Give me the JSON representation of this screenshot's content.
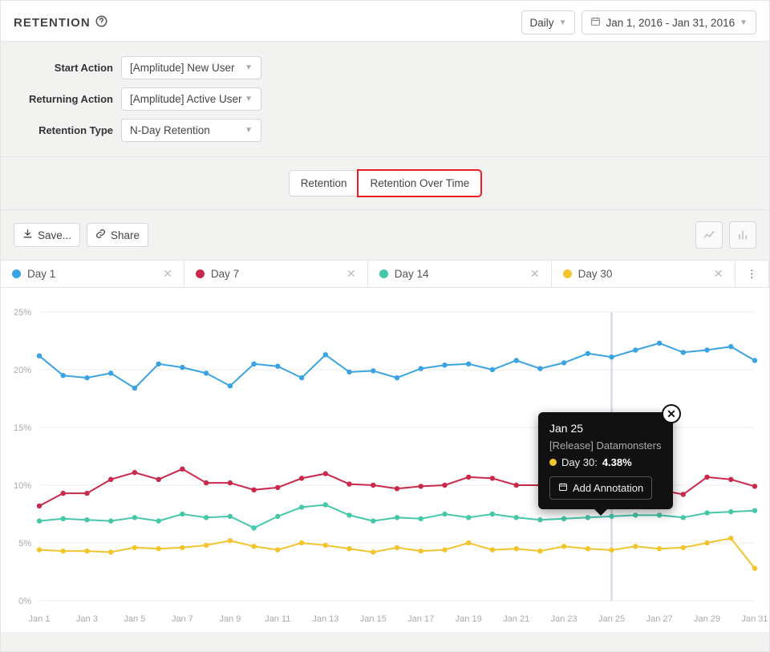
{
  "header": {
    "title": "RETENTION",
    "interval_label": "Daily",
    "date_range": "Jan 1, 2016 - Jan 31, 2016"
  },
  "filters": {
    "start_action_label": "Start Action",
    "start_action_value": "[Amplitude] New User",
    "returning_action_label": "Returning Action",
    "returning_action_value": "[Amplitude] Active User",
    "retention_type_label": "Retention Type",
    "retention_type_value": "N-Day Retention"
  },
  "tabs": {
    "retention": "Retention",
    "retention_over_time": "Retention Over Time"
  },
  "toolbar": {
    "save_label": "Save...",
    "share_label": "Share"
  },
  "legend": [
    {
      "label": "Day 1",
      "color": "#3aa3e3"
    },
    {
      "label": "Day 7",
      "color": "#c9294a"
    },
    {
      "label": "Day 14",
      "color": "#45c7aa"
    },
    {
      "label": "Day 30",
      "color": "#f2c52f"
    }
  ],
  "tooltip": {
    "date": "Jan 25",
    "subtitle": "[Release] Datamonsters",
    "series_label": "Day 30:",
    "value": "4.38%",
    "series_color": "#f2c52f",
    "add_annotation": "Add Annotation"
  },
  "chart_data": {
    "type": "line",
    "title": "Retention Over Time",
    "xlabel": "",
    "ylabel": "",
    "ylim": [
      0,
      25
    ],
    "y_ticks_pct": [
      0,
      5,
      10,
      15,
      20,
      25
    ],
    "x_tick_labels": [
      "Jan 1",
      "Jan 3",
      "Jan 5",
      "Jan 7",
      "Jan 9",
      "Jan 11",
      "Jan 13",
      "Jan 15",
      "Jan 17",
      "Jan 19",
      "Jan 21",
      "Jan 23",
      "Jan 25",
      "Jan 27",
      "Jan 29",
      "Jan 31"
    ],
    "categories": [
      "Jan 1",
      "Jan 2",
      "Jan 3",
      "Jan 4",
      "Jan 5",
      "Jan 6",
      "Jan 7",
      "Jan 8",
      "Jan 9",
      "Jan 10",
      "Jan 11",
      "Jan 12",
      "Jan 13",
      "Jan 14",
      "Jan 15",
      "Jan 16",
      "Jan 17",
      "Jan 18",
      "Jan 19",
      "Jan 20",
      "Jan 21",
      "Jan 22",
      "Jan 23",
      "Jan 24",
      "Jan 25",
      "Jan 26",
      "Jan 27",
      "Jan 28",
      "Jan 29",
      "Jan 30",
      "Jan 31"
    ],
    "series": [
      {
        "name": "Day 1",
        "color": "#3aa3e3",
        "values": [
          21.2,
          19.5,
          19.3,
          19.7,
          18.4,
          20.5,
          20.2,
          19.7,
          18.6,
          20.5,
          20.3,
          19.3,
          21.3,
          19.8,
          19.9,
          19.3,
          20.1,
          20.4,
          20.5,
          20.0,
          20.8,
          20.1,
          20.6,
          21.4,
          21.1,
          21.7,
          22.3,
          21.5,
          21.7,
          22.0,
          20.8
        ]
      },
      {
        "name": "Day 7",
        "color": "#c9294a",
        "values": [
          8.2,
          9.3,
          9.3,
          10.5,
          11.1,
          10.5,
          11.4,
          10.2,
          10.2,
          9.6,
          9.8,
          10.6,
          11.0,
          10.1,
          10.0,
          9.7,
          9.9,
          10.0,
          10.7,
          10.6,
          10.0,
          10.0,
          10.1,
          9.7,
          9.5,
          9.5,
          9.6,
          9.2,
          10.7,
          10.5,
          9.9
        ]
      },
      {
        "name": "Day 14",
        "color": "#45c7aa",
        "values": [
          6.9,
          7.1,
          7.0,
          6.9,
          7.2,
          6.9,
          7.5,
          7.2,
          7.3,
          6.3,
          7.3,
          8.1,
          8.3,
          7.4,
          6.9,
          7.2,
          7.1,
          7.5,
          7.2,
          7.5,
          7.2,
          7.0,
          7.1,
          7.2,
          7.3,
          7.4,
          7.4,
          7.2,
          7.6,
          7.7,
          7.8
        ]
      },
      {
        "name": "Day 30",
        "color": "#f2c52f",
        "values": [
          4.4,
          4.3,
          4.3,
          4.2,
          4.6,
          4.5,
          4.6,
          4.8,
          5.2,
          4.7,
          4.4,
          5.0,
          4.8,
          4.5,
          4.2,
          4.6,
          4.3,
          4.4,
          5.0,
          4.4,
          4.5,
          4.3,
          4.7,
          4.5,
          4.38,
          4.7,
          4.5,
          4.6,
          5.0,
          5.4,
          2.8
        ]
      }
    ]
  }
}
